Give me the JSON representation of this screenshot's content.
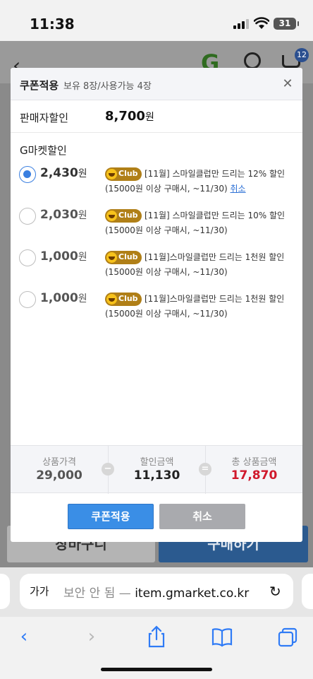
{
  "status_bar": {
    "time": "11:38",
    "battery": "31"
  },
  "background_page": {
    "cart_count": "12",
    "bottom_left_label": "장바구니",
    "bottom_right_label": "구매하기"
  },
  "modal": {
    "title": "쿠폰적용",
    "subtitle": "보유 8장/사용가능 4장",
    "seller_discount": {
      "label": "판매자할인",
      "amount": "8,700",
      "unit": "원"
    },
    "gmarket_title": "G마켓할인",
    "coupons": [
      {
        "amount": "2,430",
        "unit": "원",
        "selected": true,
        "badge": "Club",
        "line1": "[11월] 스마일클럽만 드리는 12% 할인",
        "line2": "(15000원 이상 구매시, ~11/30)",
        "cancel_label": "취소"
      },
      {
        "amount": "2,030",
        "unit": "원",
        "selected": false,
        "badge": "Club",
        "line1": "[11월] 스마일클럽만 드리는 10% 할인",
        "line2": "(15000원 이상 구매시, ~11/30)"
      },
      {
        "amount": "1,000",
        "unit": "원",
        "selected": false,
        "badge": "Club",
        "line1": "[11월]스마일클럽만 드리는 1천원 할인",
        "line2": "(15000원 이상 구매시, ~11/30)"
      },
      {
        "amount": "1,000",
        "unit": "원",
        "selected": false,
        "badge": "Club",
        "line1": "[11월]스마일클럽만 드리는 1천원 할인",
        "line2": "(15000원 이상 구매시, ~11/30)"
      }
    ],
    "summary": {
      "price_label": "상품가격",
      "price_value": "29,000",
      "minus": "−",
      "discount_label": "할인금액",
      "discount_value": "11,130",
      "equals": "=",
      "total_label": "총 상품금액",
      "total_value": "17,870"
    },
    "apply_button": "쿠폰적용",
    "cancel_button": "취소"
  },
  "safari": {
    "aa_label": "가가",
    "url_insecure": "보안 안 됨 — ",
    "url_domain": "item.gmarket.co.kr"
  },
  "colors": {
    "accent": "#3a8ee6",
    "total_red": "#d0192c",
    "club_gold": "#b07f17"
  },
  "icons": [
    "back-arrow-icon",
    "search-icon",
    "cart-icon",
    "close-icon",
    "reload-icon",
    "share-icon",
    "bookmarks-icon",
    "tabs-icon",
    "forward-arrow-icon"
  ]
}
